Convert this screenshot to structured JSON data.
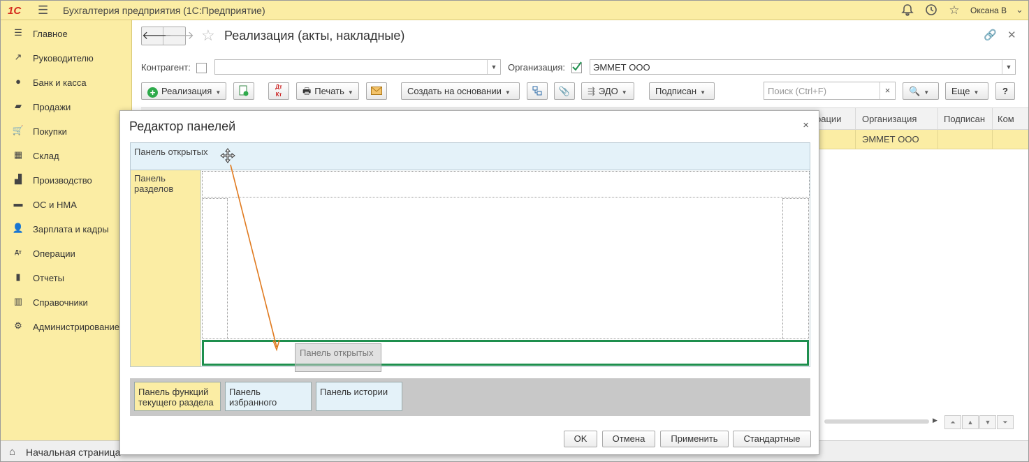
{
  "app": {
    "title": "Бухгалтерия предприятия  (1С:Предприятие)",
    "logo_text": "1С",
    "user": "Оксана В"
  },
  "sidebar": {
    "items": [
      {
        "label": "Главное",
        "icon": "menu-lines-icon"
      },
      {
        "label": "Руководителю",
        "icon": "trend-icon"
      },
      {
        "label": "Банк и касса",
        "icon": "coin-icon"
      },
      {
        "label": "Продажи",
        "icon": "bag-icon"
      },
      {
        "label": "Покупки",
        "icon": "cart-icon"
      },
      {
        "label": "Склад",
        "icon": "grid-icon"
      },
      {
        "label": "Производство",
        "icon": "factory-icon"
      },
      {
        "label": "ОС и НМА",
        "icon": "truck-icon"
      },
      {
        "label": "Зарплата и кадры",
        "icon": "person-icon"
      },
      {
        "label": "Операции",
        "icon": "dt-kt-icon"
      },
      {
        "label": "Отчеты",
        "icon": "bar-chart-icon"
      },
      {
        "label": "Справочники",
        "icon": "books-icon"
      },
      {
        "label": "Администрирование",
        "icon": "gear-icon"
      }
    ]
  },
  "taskbar": {
    "home_label": "Начальная страница"
  },
  "document": {
    "title": "Реализация (акты, накладные)",
    "contractor_label": "Контрагент:",
    "contractor_value": "",
    "org_label": "Организация:",
    "org_value": "ЭММЕТ ООО",
    "org_checked": true
  },
  "toolbar": {
    "realization": "Реализация",
    "print": "Печать",
    "create_based": "Создать на основании",
    "edo": "ЭДО",
    "signed": "Подписан",
    "search_placeholder": "Поиск (Ctrl+F)",
    "search_clear": "×",
    "more": "Еще",
    "help": "?"
  },
  "grid": {
    "headers": [
      "рации",
      "Организация",
      "Подписан",
      "Ком"
    ],
    "row": [
      "ЭММЕТ ООО"
    ]
  },
  "dialog": {
    "title": "Редактор панелей",
    "close": "×",
    "panel_top": "Панель открытых",
    "panel_left": "Панель разделов",
    "dragged_panel": "Панель открытых",
    "available_panels": [
      "Панель функций текущего раздела",
      "Панель избранного",
      "Панель истории"
    ],
    "buttons": {
      "ok": "OK",
      "cancel": "Отмена",
      "apply": "Применить",
      "standard": "Стандартные"
    }
  },
  "colors": {
    "accent_yellow": "#fbeda4",
    "panel_blue": "#e4f2f9",
    "drop_green": "#1e8f4e",
    "arrow_orange": "#e07a1f"
  }
}
